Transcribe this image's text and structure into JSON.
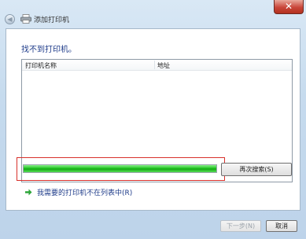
{
  "window": {
    "title": "添加打印机",
    "close_label": "✕",
    "back_label": "◀"
  },
  "heading": "找不到打印机。",
  "printer_list": {
    "columns": [
      "打印机名称",
      "地址"
    ],
    "rows": []
  },
  "progress": {
    "value": 1.0,
    "color": "#1fbf1f"
  },
  "buttons": {
    "search_again": "再次搜索(S)",
    "next": "下一步(N)",
    "cancel": "取消"
  },
  "link": {
    "label": "我需要的打印机不在列表中(R)"
  },
  "icons": {
    "back": "back-arrow-icon",
    "printer": "printer-icon",
    "link_arrow": "green-arrow-icon",
    "close": "close-icon"
  }
}
